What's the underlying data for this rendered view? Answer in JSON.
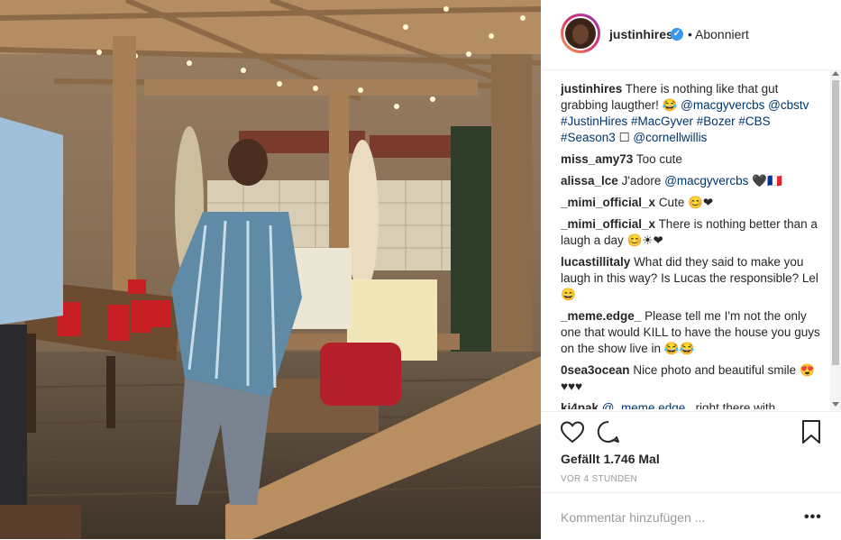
{
  "post": {
    "username": "justinhires",
    "follow_status": "• Abonniert",
    "verified_icon": "verified-check-icon"
  },
  "comments": [
    {
      "user": "justinhires",
      "parts": [
        {
          "t": "There is nothing like that gut grabbing laugther! 😂 ",
          "link": false
        },
        {
          "t": "@macgyvercbs @cbstv #JustinHires #MacGyver #Bozer #CBS #Season3",
          "link": true
        },
        {
          "t": " ☐ ",
          "link": false
        },
        {
          "t": "@cornellwillis",
          "link": true
        }
      ]
    },
    {
      "user": "miss_amy73",
      "parts": [
        {
          "t": "Too cute",
          "link": false
        }
      ]
    },
    {
      "user": "alissa_lce",
      "parts": [
        {
          "t": "J'adore ",
          "link": false
        },
        {
          "t": "@macgyvercbs",
          "link": true
        },
        {
          "t": " 🖤🇫🇷",
          "link": false
        }
      ]
    },
    {
      "user": "_mimi_official_x",
      "parts": [
        {
          "t": "Cute 😊❤",
          "link": false
        }
      ]
    },
    {
      "user": "_mimi_official_x",
      "parts": [
        {
          "t": "There is nothing better than a laugh a day 😊☀❤",
          "link": false
        }
      ]
    },
    {
      "user": "lucastillitaly",
      "parts": [
        {
          "t": "What did they said to make you laugh in this way? Is Lucas the responsible? Lel 😄",
          "link": false
        }
      ]
    },
    {
      "user": "_meme.edge_",
      "parts": [
        {
          "t": "Please tell me I'm not the only one that would KILL to have the house you guys on the show live in 😂😂",
          "link": false
        }
      ]
    },
    {
      "user": "0sea3ocean",
      "parts": [
        {
          "t": "Nice photo and beautiful smile 😍♥♥♥",
          "link": false
        }
      ]
    },
    {
      "user": "ki4pak",
      "parts": [
        {
          "t": "@_meme.edge_",
          "link": true
        },
        {
          "t": " right there with",
          "link": false
        }
      ]
    }
  ],
  "actions": {
    "like_icon": "heart-icon",
    "comment_icon": "comment-icon",
    "save_icon": "bookmark-icon",
    "likes_text": "Gefällt 1.746 Mal",
    "time_text": "VOR 4 STUNDEN"
  },
  "add_comment": {
    "placeholder": "Kommentar hinzufügen ...",
    "more_label": "•••"
  },
  "colors": {
    "link": "#003569",
    "verified": "#3897f0",
    "text": "#262626",
    "muted": "#999999"
  }
}
